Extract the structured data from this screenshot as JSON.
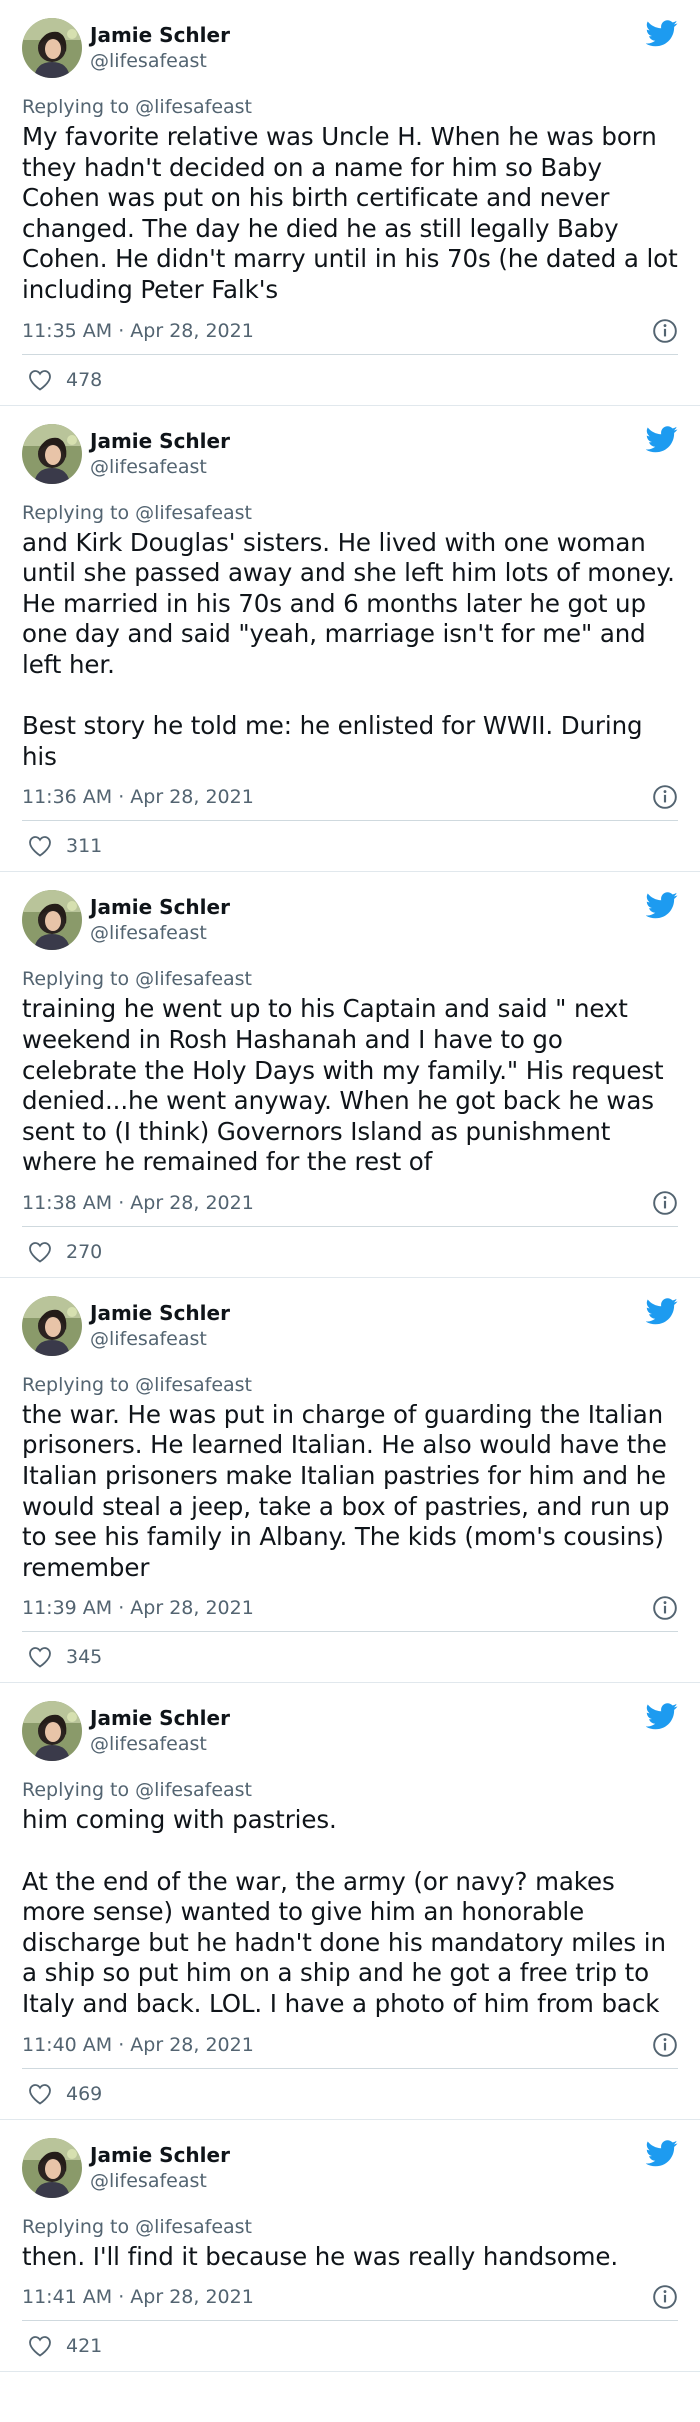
{
  "author": {
    "display_name": "Jamie Schler",
    "handle": "@lifesafeast"
  },
  "replying_to": "Replying to @lifesafeast",
  "icons": {
    "brand": "twitter-bird-icon",
    "info": "info-icon",
    "like": "heart-icon"
  },
  "colors": {
    "brand_blue": "#1d9bf0",
    "secondary_text": "#536471"
  },
  "tweets": [
    {
      "text": "My favorite relative was Uncle H. When he was born they hadn't decided on a name for him so Baby Cohen was put on his birth certificate and never changed. The day he died he as still legally Baby Cohen. He didn't marry until in his 70s (he dated a lot including Peter Falk's",
      "timestamp": "11:35 AM · Apr 28, 2021",
      "likes": "478"
    },
    {
      "text": "and Kirk Douglas' sisters. He lived with one woman until she passed away and she left him lots of money. He married in his 70s and 6 months later he got up one day and said \"yeah, marriage isn't for me\" and left her.\n\nBest story he told me: he enlisted for WWII. During his",
      "timestamp": "11:36 AM · Apr 28, 2021",
      "likes": "311"
    },
    {
      "text": "training he went up to his Captain and said \" next weekend in Rosh Hashanah and I have to go celebrate the Holy Days with my family.\" His request denied...he went anyway. When he got back he was sent to (I think) Governors Island as punishment where he remained for the rest of",
      "timestamp": "11:38 AM · Apr 28, 2021",
      "likes": "270"
    },
    {
      "text": "the war. He was put in charge of guarding the Italian prisoners. He learned Italian. He also would have the Italian prisoners make Italian pastries for him and he would steal a jeep, take a box of pastries, and run up to see his family in Albany. The kids (mom's cousins) remember",
      "timestamp": "11:39 AM · Apr 28, 2021",
      "likes": "345"
    },
    {
      "text": "him coming with pastries.\n\nAt the end of the war, the army (or navy? makes more sense) wanted to give him an honorable discharge but he hadn't done his mandatory miles in a ship so put him on a ship and he got a free trip to Italy and back. LOL. I have a photo of him from back",
      "timestamp": "11:40 AM · Apr 28, 2021",
      "likes": "469"
    },
    {
      "text": "then. I'll find it because he was really handsome.",
      "timestamp": "11:41 AM · Apr 28, 2021",
      "likes": "421"
    }
  ]
}
